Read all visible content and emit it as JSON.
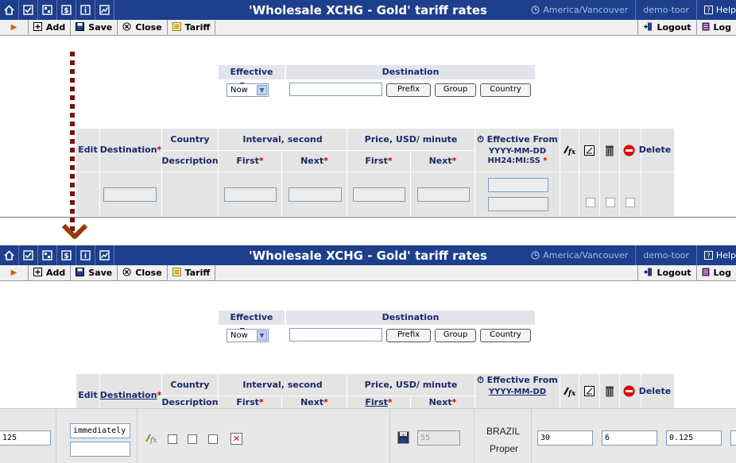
{
  "titlebar": {
    "title": "'Wholesale XCHG - Gold' tariff rates",
    "timezone": "America/Vancouver",
    "user": "demo-toor",
    "help": "Help",
    "icons": [
      "home-icon",
      "checkbox-icon",
      "network-icon",
      "dollar-icon",
      "info-icon",
      "chart-icon"
    ]
  },
  "toolbar": {
    "add": "Add",
    "save": "Save",
    "close": "Close",
    "tariff": "Tariff",
    "logout": "Logout",
    "log": "Log"
  },
  "filter": {
    "effective_from_header": "Effective From",
    "destination_header": "Destination",
    "effective_from_value": "Now",
    "destination_value": "",
    "prefix_button": "Prefix",
    "group_button": "Group",
    "country_button": "Country"
  },
  "grid": {
    "edit": "Edit",
    "destination": "Destination",
    "country": "Country",
    "description": "Description",
    "interval": "Interval, second",
    "price": "Price, USD/ minute",
    "first": "First",
    "next": "Next",
    "effective_from": "Effective From",
    "date_format": "YYYY-MM-DD",
    "time_format": "HH24:MI:SS",
    "delete": "Delete",
    "required_mark": "*"
  },
  "edit_row": {
    "first_value": "125",
    "effective_from_value": "immediately",
    "prefix_value": "55",
    "country": "BRAZIL",
    "description": "Proper",
    "interval_first": "30",
    "interval_next": "6",
    "price_first": "0.125"
  },
  "colors": {
    "titlebar_bg": "#1d3f8c",
    "grid_bg": "#e4e4e4",
    "header_text": "#1a2a6a",
    "dots": "#7a1410",
    "required": "#d00000"
  }
}
